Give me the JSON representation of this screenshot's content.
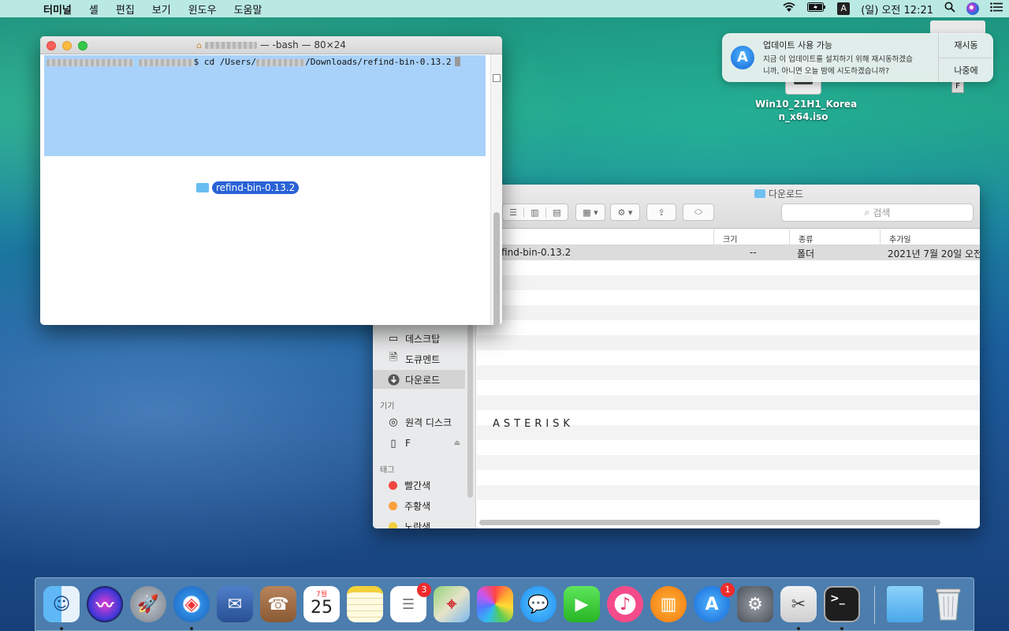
{
  "menubar": {
    "items": [
      "터미널",
      "셸",
      "편집",
      "보기",
      "윈도우",
      "도움말"
    ],
    "ime": "A",
    "clock": "(일) 오전 12:21"
  },
  "desktop": {
    "file_name_line1": "Win10_21H1_Korea",
    "file_name_line2": "n_x64.iso",
    "drive_letter": "F"
  },
  "notification": {
    "title": "업데이트 사용 가능",
    "line1": "지금 이 업데이트를 설치하기 위해 재시동하겠습",
    "line2": "니까, 아니면 오늘 밤에 시도하겠습니까?",
    "restart": "재시동",
    "later": "나중에"
  },
  "terminal": {
    "title_suffix": "— -bash — 80×24",
    "prompt_end": "$ cd /Users/",
    "path_end": "/Downloads/refind-bin-0.13.2",
    "drag_label": "refind-bin-0.13.2"
  },
  "finder": {
    "title": "다운로드",
    "search_placeholder": "검색",
    "columns": {
      "size": "크기",
      "kind": "종류",
      "date": "추가일"
    },
    "row": {
      "name": "refind-bin-0.13.2",
      "size": "--",
      "kind": "폴더",
      "date": "2021년 7월 20일 오전"
    },
    "sidebar": {
      "desktop": "데스크탑",
      "documents": "도큐멘트",
      "downloads": "다운로드",
      "devices_header": "기기",
      "remote_disc": "원격 디스크",
      "drive_f": "F",
      "tags_header": "태그",
      "red": "빨간색",
      "orange": "주황색",
      "yellow": "노란색"
    },
    "overlay_text": "ASTERISK"
  },
  "dock": {
    "calendar_month": "7월",
    "calendar_day": "25",
    "reminders_badge": "3",
    "appstore_badge": "1"
  },
  "colors": {
    "selection": "#a9d2fa",
    "drag_label_bg": "#2a62d6",
    "badge": "#f02b2b"
  }
}
